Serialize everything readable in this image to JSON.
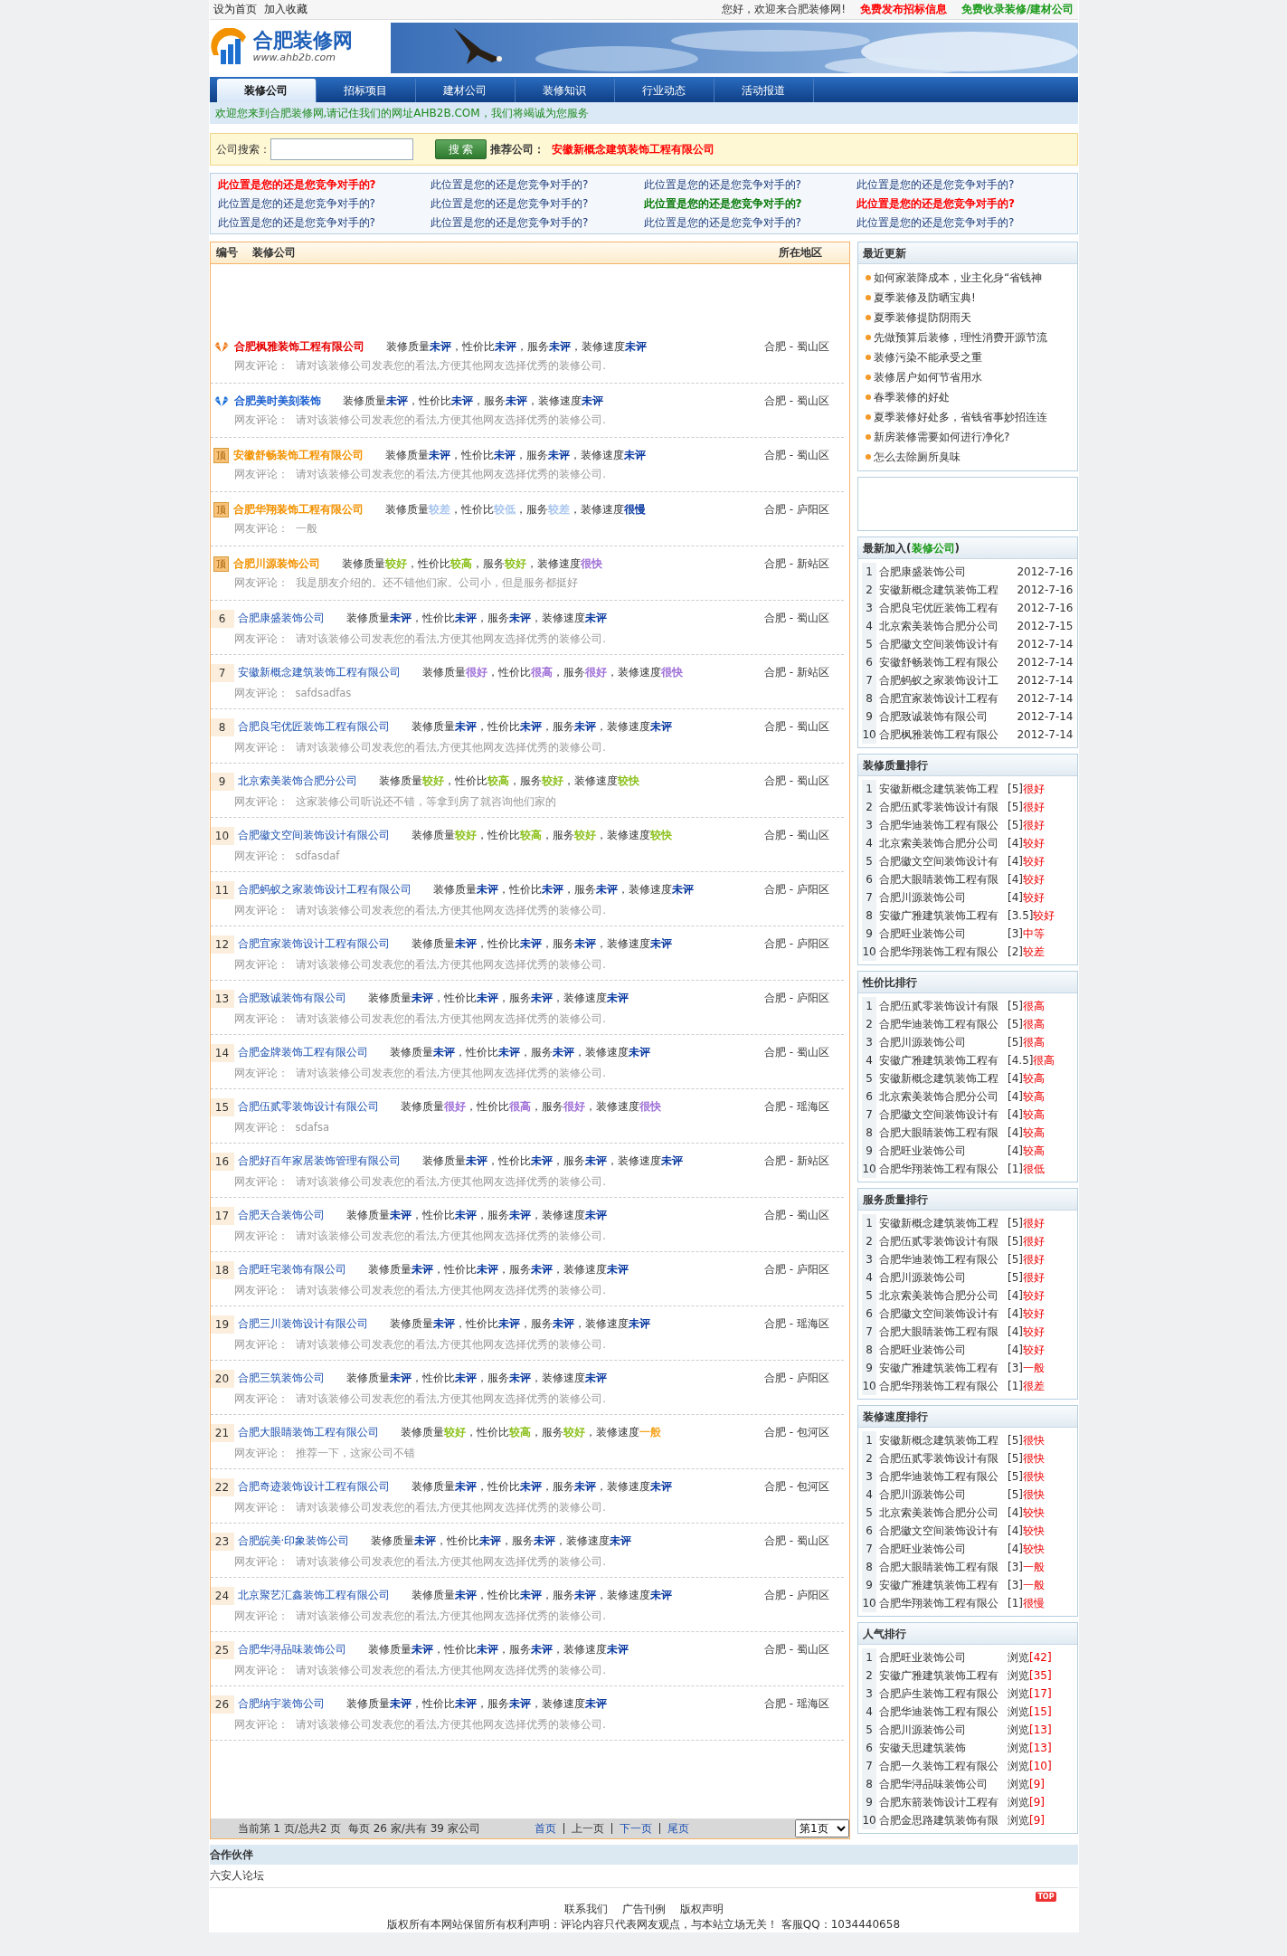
{
  "top_bar": {
    "left_links": [
      "设为首页",
      "加入收藏"
    ],
    "greeting": "您好，欢迎来合肥装修网!",
    "links": [
      {
        "text": "免费发布招标信息",
        "color": "#ff0000"
      },
      {
        "text": "免费收录装修/建材公司",
        "color": "#1a9a1a"
      }
    ]
  },
  "logo": {
    "title": "合肥装修网",
    "url": "www.ahb2b.com"
  },
  "nav": [
    {
      "label": "装修公司",
      "selected": true
    },
    {
      "label": "招标项目",
      "selected": false
    },
    {
      "label": "建材公司",
      "selected": false
    },
    {
      "label": "装修知识",
      "selected": false
    },
    {
      "label": "行业动态",
      "selected": false
    },
    {
      "label": "活动报道",
      "selected": false
    }
  ],
  "welcome": "欢迎您来到合肥装修网,请记住我们的网址AHB2B.COM，我们将竭诚为您服务",
  "search": {
    "label": "公司搜索：",
    "button": "搜 索",
    "recommend_label": "推荐公司：",
    "recommend": "安徽新概念建筑装饰工程有限公司"
  },
  "ads": [
    {
      "text": "此位置是您的还是您竞争对手的?",
      "kind": "red"
    },
    {
      "text": "此位置是您的还是您竞争对手的?",
      "kind": "plain"
    },
    {
      "text": "此位置是您的还是您竞争对手的?",
      "kind": "plain"
    },
    {
      "text": "此位置是您的还是您竞争对手的?",
      "kind": "plain"
    },
    {
      "text": "此位置是您的还是您竞争对手的?",
      "kind": "plain"
    },
    {
      "text": "此位置是您的还是您竞争对手的?",
      "kind": "plain"
    },
    {
      "text": "此位置是您的还是您竞争对手的?",
      "kind": "green"
    },
    {
      "text": "此位置是您的还是您竞争对手的?",
      "kind": "red"
    },
    {
      "text": "此位置是您的还是您竞争对手的?",
      "kind": "plain"
    },
    {
      "text": "此位置是您的还是您竞争对手的?",
      "kind": "plain"
    },
    {
      "text": "此位置是您的还是您竞争对手的?",
      "kind": "plain"
    },
    {
      "text": "此位置是您的还是您竞争对手的?",
      "kind": "plain"
    }
  ],
  "list": {
    "columns": [
      "编号",
      "装修公司",
      "所在地区"
    ],
    "rows": [
      {
        "kind": "gold",
        "name": "合肥枫雅装饰工程有限公司",
        "ratings": [
          {
            "label": "装修质量",
            "value": "未评",
            "color": "#0a3aa0"
          },
          {
            "label": "，性价比",
            "value": "未评",
            "color": "#0a3aa0"
          },
          {
            "label": "，服务",
            "value": "未评",
            "color": "#0a3aa0"
          },
          {
            "label": "，装修速度",
            "value": "未评",
            "color": "#0a3aa0"
          }
        ],
        "area": "合肥 - 蜀山区",
        "comment_label": "网友评论：",
        "comment": "请对该装修公司发表您的看法,方便其他网友选择优秀的装修公司."
      },
      {
        "kind": "silver",
        "name": "合肥美时美刻装饰",
        "ratings": [
          {
            "label": "装修质量",
            "value": "未评",
            "color": "#0a3aa0"
          },
          {
            "label": "，性价比",
            "value": "未评",
            "color": "#0a3aa0"
          },
          {
            "label": "，服务",
            "value": "未评",
            "color": "#0a3aa0"
          },
          {
            "label": "，装修速度",
            "value": "未评",
            "color": "#0a3aa0"
          }
        ],
        "area": "合肥 - 蜀山区",
        "comment_label": "网友评论：",
        "comment": "请对该装修公司发表您的看法,方便其他网友选择优秀的装修公司."
      },
      {
        "kind": "top",
        "badge": "顶",
        "name": "安徽舒畅装饰工程有限公司",
        "ratings": [
          {
            "label": "装修质量",
            "value": "未评",
            "color": "#0a3aa0"
          },
          {
            "label": "，性价比",
            "value": "未评",
            "color": "#0a3aa0"
          },
          {
            "label": "，服务",
            "value": "未评",
            "color": "#0a3aa0"
          },
          {
            "label": "，装修速度",
            "value": "未评",
            "color": "#0a3aa0"
          }
        ],
        "area": "合肥 - 蜀山区",
        "comment_label": "网友评论：",
        "comment": "请对该装修公司发表您的看法,方便其他网友选择优秀的装修公司."
      },
      {
        "kind": "top",
        "badge": "顶",
        "name": "合肥华翔装饰工程有限公司",
        "ratings": [
          {
            "label": "装修质量",
            "value": "较差",
            "color": "#a9c6ee"
          },
          {
            "label": "，性价比",
            "value": "较低",
            "color": "#a9c6ee"
          },
          {
            "label": "，服务",
            "value": "较差",
            "color": "#a9c6ee"
          },
          {
            "label": "，装修速度",
            "value": "很慢",
            "color": "#0a3aa0"
          }
        ],
        "area": "合肥 - 庐阳区",
        "comment_label": "网友评论：",
        "comment": "一般"
      },
      {
        "kind": "top",
        "badge": "顶",
        "name": "合肥川源装饰公司",
        "ratings": [
          {
            "label": "装修质量",
            "value": "较好",
            "color": "#8dc21f"
          },
          {
            "label": "，性价比",
            "value": "较高",
            "color": "#8dc21f"
          },
          {
            "label": "，服务",
            "value": "较好",
            "color": "#8dc21f"
          },
          {
            "label": "，装修速度",
            "value": "很快",
            "color": "#a070d8"
          }
        ],
        "area": "合肥 - 新站区",
        "comment_label": "网友评论：",
        "comment": "我是朋友介绍的。还不错他们家。公司小，但是服务都挺好"
      },
      {
        "kind": "normal",
        "no": "6",
        "name": "合肥康盛装饰公司",
        "ratings": [
          {
            "label": "装修质量",
            "value": "未评",
            "color": "#0a3aa0"
          },
          {
            "label": "，性价比",
            "value": "未评",
            "color": "#0a3aa0"
          },
          {
            "label": "，服务",
            "value": "未评",
            "color": "#0a3aa0"
          },
          {
            "label": "，装修速度",
            "value": "未评",
            "color": "#0a3aa0"
          }
        ],
        "area": "合肥 - 蜀山区",
        "comment_label": "网友评论：",
        "comment": "请对该装修公司发表您的看法,方便其他网友选择优秀的装修公司."
      },
      {
        "kind": "normal",
        "no": "7",
        "name": "安徽新概念建筑装饰工程有限公司",
        "ratings": [
          {
            "label": "装修质量",
            "value": "很好",
            "color": "#a070d8"
          },
          {
            "label": "，性价比",
            "value": "很高",
            "color": "#a070d8"
          },
          {
            "label": "，服务",
            "value": "很好",
            "color": "#a070d8"
          },
          {
            "label": "，装修速度",
            "value": "很快",
            "color": "#a070d8"
          }
        ],
        "area": "合肥 - 新站区",
        "comment_label": "网友评论：",
        "comment": "safdsadfas"
      },
      {
        "kind": "normal",
        "no": "8",
        "name": "合肥良宅优匠装饰工程有限公司",
        "ratings": [
          {
            "label": "装修质量",
            "value": "未评",
            "color": "#0a3aa0"
          },
          {
            "label": "，性价比",
            "value": "未评",
            "color": "#0a3aa0"
          },
          {
            "label": "，服务",
            "value": "未评",
            "color": "#0a3aa0"
          },
          {
            "label": "，装修速度",
            "value": "未评",
            "color": "#0a3aa0"
          }
        ],
        "area": "合肥 - 蜀山区",
        "comment_label": "网友评论：",
        "comment": "请对该装修公司发表您的看法,方便其他网友选择优秀的装修公司."
      },
      {
        "kind": "normal",
        "no": "9",
        "name": "北京索美装饰合肥分公司",
        "ratings": [
          {
            "label": "装修质量",
            "value": "较好",
            "color": "#8dc21f"
          },
          {
            "label": "，性价比",
            "value": "较高",
            "color": "#8dc21f"
          },
          {
            "label": "，服务",
            "value": "较好",
            "color": "#8dc21f"
          },
          {
            "label": "，装修速度",
            "value": "较快",
            "color": "#8dc21f"
          }
        ],
        "area": "合肥 - 蜀山区",
        "comment_label": "网友评论：",
        "comment": "这家装修公司听说还不错，等拿到房了就咨询他们家的"
      },
      {
        "kind": "normal",
        "no": "10",
        "name": "合肥徽文空间装饰设计有限公司",
        "ratings": [
          {
            "label": "装修质量",
            "value": "较好",
            "color": "#8dc21f"
          },
          {
            "label": "，性价比",
            "value": "较高",
            "color": "#8dc21f"
          },
          {
            "label": "，服务",
            "value": "较好",
            "color": "#8dc21f"
          },
          {
            "label": "，装修速度",
            "value": "较快",
            "color": "#8dc21f"
          }
        ],
        "area": "合肥 - 蜀山区",
        "comment_label": "网友评论：",
        "comment": "sdfasdaf"
      },
      {
        "kind": "normal",
        "no": "11",
        "name": "合肥蚂蚁之家装饰设计工程有限公司",
        "ratings": [
          {
            "label": "装修质量",
            "value": "未评",
            "color": "#0a3aa0"
          },
          {
            "label": "，性价比",
            "value": "未评",
            "color": "#0a3aa0"
          },
          {
            "label": "，服务",
            "value": "未评",
            "color": "#0a3aa0"
          },
          {
            "label": "，装修速度",
            "value": "未评",
            "color": "#0a3aa0"
          }
        ],
        "area": "合肥 - 庐阳区",
        "comment_label": "网友评论：",
        "comment": "请对该装修公司发表您的看法,方便其他网友选择优秀的装修公司."
      },
      {
        "kind": "normal",
        "no": "12",
        "name": "合肥宜家装饰设计工程有限公司",
        "ratings": [
          {
            "label": "装修质量",
            "value": "未评",
            "color": "#0a3aa0"
          },
          {
            "label": "，性价比",
            "value": "未评",
            "color": "#0a3aa0"
          },
          {
            "label": "，服务",
            "value": "未评",
            "color": "#0a3aa0"
          },
          {
            "label": "，装修速度",
            "value": "未评",
            "color": "#0a3aa0"
          }
        ],
        "area": "合肥 - 庐阳区",
        "comment_label": "网友评论：",
        "comment": "请对该装修公司发表您的看法,方便其他网友选择优秀的装修公司."
      },
      {
        "kind": "normal",
        "no": "13",
        "name": "合肥致诚装饰有限公司",
        "ratings": [
          {
            "label": "装修质量",
            "value": "未评",
            "color": "#0a3aa0"
          },
          {
            "label": "，性价比",
            "value": "未评",
            "color": "#0a3aa0"
          },
          {
            "label": "，服务",
            "value": "未评",
            "color": "#0a3aa0"
          },
          {
            "label": "，装修速度",
            "value": "未评",
            "color": "#0a3aa0"
          }
        ],
        "area": "合肥 - 庐阳区",
        "comment_label": "网友评论：",
        "comment": "请对该装修公司发表您的看法,方便其他网友选择优秀的装修公司."
      },
      {
        "kind": "normal",
        "no": "14",
        "name": "合肥金牌装饰工程有限公司",
        "ratings": [
          {
            "label": "装修质量",
            "value": "未评",
            "color": "#0a3aa0"
          },
          {
            "label": "，性价比",
            "value": "未评",
            "color": "#0a3aa0"
          },
          {
            "label": "，服务",
            "value": "未评",
            "color": "#0a3aa0"
          },
          {
            "label": "，装修速度",
            "value": "未评",
            "color": "#0a3aa0"
          }
        ],
        "area": "合肥 - 蜀山区",
        "comment_label": "网友评论：",
        "comment": "请对该装修公司发表您的看法,方便其他网友选择优秀的装修公司."
      },
      {
        "kind": "normal",
        "no": "15",
        "name": "合肥伍贰零装饰设计有限公司",
        "ratings": [
          {
            "label": "装修质量",
            "value": "很好",
            "color": "#a070d8"
          },
          {
            "label": "，性价比",
            "value": "很高",
            "color": "#a070d8"
          },
          {
            "label": "，服务",
            "value": "很好",
            "color": "#a070d8"
          },
          {
            "label": "，装修速度",
            "value": "很快",
            "color": "#a070d8"
          }
        ],
        "area": "合肥 - 瑶海区",
        "comment_label": "网友评论：",
        "comment": "sdafsa"
      },
      {
        "kind": "normal",
        "no": "16",
        "name": "合肥好百年家居装饰管理有限公司",
        "ratings": [
          {
            "label": "装修质量",
            "value": "未评",
            "color": "#0a3aa0"
          },
          {
            "label": "，性价比",
            "value": "未评",
            "color": "#0a3aa0"
          },
          {
            "label": "，服务",
            "value": "未评",
            "color": "#0a3aa0"
          },
          {
            "label": "，装修速度",
            "value": "未评",
            "color": "#0a3aa0"
          }
        ],
        "area": "合肥 - 新站区",
        "comment_label": "网友评论：",
        "comment": "请对该装修公司发表您的看法,方便其他网友选择优秀的装修公司."
      },
      {
        "kind": "normal",
        "no": "17",
        "name": "合肥天合装饰公司",
        "ratings": [
          {
            "label": "装修质量",
            "value": "未评",
            "color": "#0a3aa0"
          },
          {
            "label": "，性价比",
            "value": "未评",
            "color": "#0a3aa0"
          },
          {
            "label": "，服务",
            "value": "未评",
            "color": "#0a3aa0"
          },
          {
            "label": "，装修速度",
            "value": "未评",
            "color": "#0a3aa0"
          }
        ],
        "area": "合肥 - 蜀山区",
        "comment_label": "网友评论：",
        "comment": "请对该装修公司发表您的看法,方便其他网友选择优秀的装修公司."
      },
      {
        "kind": "normal",
        "no": "18",
        "name": "合肥旺宅装饰有限公司",
        "ratings": [
          {
            "label": "装修质量",
            "value": "未评",
            "color": "#0a3aa0"
          },
          {
            "label": "，性价比",
            "value": "未评",
            "color": "#0a3aa0"
          },
          {
            "label": "，服务",
            "value": "未评",
            "color": "#0a3aa0"
          },
          {
            "label": "，装修速度",
            "value": "未评",
            "color": "#0a3aa0"
          }
        ],
        "area": "合肥 - 庐阳区",
        "comment_label": "网友评论：",
        "comment": "请对该装修公司发表您的看法,方便其他网友选择优秀的装修公司."
      },
      {
        "kind": "normal",
        "no": "19",
        "name": "合肥三川装饰设计有限公司",
        "ratings": [
          {
            "label": "装修质量",
            "value": "未评",
            "color": "#0a3aa0"
          },
          {
            "label": "，性价比",
            "value": "未评",
            "color": "#0a3aa0"
          },
          {
            "label": "，服务",
            "value": "未评",
            "color": "#0a3aa0"
          },
          {
            "label": "，装修速度",
            "value": "未评",
            "color": "#0a3aa0"
          }
        ],
        "area": "合肥 - 瑶海区",
        "comment_label": "网友评论：",
        "comment": "请对该装修公司发表您的看法,方便其他网友选择优秀的装修公司."
      },
      {
        "kind": "normal",
        "no": "20",
        "name": "合肥三筑装饰公司",
        "ratings": [
          {
            "label": "装修质量",
            "value": "未评",
            "color": "#0a3aa0"
          },
          {
            "label": "，性价比",
            "value": "未评",
            "color": "#0a3aa0"
          },
          {
            "label": "，服务",
            "value": "未评",
            "color": "#0a3aa0"
          },
          {
            "label": "，装修速度",
            "value": "未评",
            "color": "#0a3aa0"
          }
        ],
        "area": "合肥 - 庐阳区",
        "comment_label": "网友评论：",
        "comment": "请对该装修公司发表您的看法,方便其他网友选择优秀的装修公司."
      },
      {
        "kind": "normal",
        "no": "21",
        "name": "合肥大眼睛装饰工程有限公司",
        "ratings": [
          {
            "label": "装修质量",
            "value": "较好",
            "color": "#8dc21f"
          },
          {
            "label": "，性价比",
            "value": "较高",
            "color": "#8dc21f"
          },
          {
            "label": "，服务",
            "value": "较好",
            "color": "#8dc21f"
          },
          {
            "label": "，装修速度",
            "value": "一般",
            "color": "#f5a623"
          }
        ],
        "area": "合肥 - 包河区",
        "comment_label": "网友评论：",
        "comment": "推荐一下，这家公司不错"
      },
      {
        "kind": "normal",
        "no": "22",
        "name": "合肥奇迹装饰设计工程有限公司",
        "ratings": [
          {
            "label": "装修质量",
            "value": "未评",
            "color": "#0a3aa0"
          },
          {
            "label": "，性价比",
            "value": "未评",
            "color": "#0a3aa0"
          },
          {
            "label": "，服务",
            "value": "未评",
            "color": "#0a3aa0"
          },
          {
            "label": "，装修速度",
            "value": "未评",
            "color": "#0a3aa0"
          }
        ],
        "area": "合肥 - 包河区",
        "comment_label": "网友评论：",
        "comment": "请对该装修公司发表您的看法,方便其他网友选择优秀的装修公司."
      },
      {
        "kind": "normal",
        "no": "23",
        "name": "合肥皖美·印象装饰公司",
        "ratings": [
          {
            "label": "装修质量",
            "value": "未评",
            "color": "#0a3aa0"
          },
          {
            "label": "，性价比",
            "value": "未评",
            "color": "#0a3aa0"
          },
          {
            "label": "，服务",
            "value": "未评",
            "color": "#0a3aa0"
          },
          {
            "label": "，装修速度",
            "value": "未评",
            "color": "#0a3aa0"
          }
        ],
        "area": "合肥 - 蜀山区",
        "comment_label": "网友评论：",
        "comment": "请对该装修公司发表您的看法,方便其他网友选择优秀的装修公司."
      },
      {
        "kind": "normal",
        "no": "24",
        "name": "北京聚艺汇鑫装饰工程有限公司",
        "ratings": [
          {
            "label": "装修质量",
            "value": "未评",
            "color": "#0a3aa0"
          },
          {
            "label": "，性价比",
            "value": "未评",
            "color": "#0a3aa0"
          },
          {
            "label": "，服务",
            "value": "未评",
            "color": "#0a3aa0"
          },
          {
            "label": "，装修速度",
            "value": "未评",
            "color": "#0a3aa0"
          }
        ],
        "area": "合肥 - 庐阳区",
        "comment_label": "网友评论：",
        "comment": "请对该装修公司发表您的看法,方便其他网友选择优秀的装修公司."
      },
      {
        "kind": "normal",
        "no": "25",
        "name": "合肥华浔品味装饰公司",
        "ratings": [
          {
            "label": "装修质量",
            "value": "未评",
            "color": "#0a3aa0"
          },
          {
            "label": "，性价比",
            "value": "未评",
            "color": "#0a3aa0"
          },
          {
            "label": "，服务",
            "value": "未评",
            "color": "#0a3aa0"
          },
          {
            "label": "，装修速度",
            "value": "未评",
            "color": "#0a3aa0"
          }
        ],
        "area": "合肥 - 蜀山区",
        "comment_label": "网友评论：",
        "comment": "请对该装修公司发表您的看法,方便其他网友选择优秀的装修公司."
      },
      {
        "kind": "normal",
        "no": "26",
        "name": "合肥纳宇装饰公司",
        "ratings": [
          {
            "label": "装修质量",
            "value": "未评",
            "color": "#0a3aa0"
          },
          {
            "label": "，性价比",
            "value": "未评",
            "color": "#0a3aa0"
          },
          {
            "label": "，服务",
            "value": "未评",
            "color": "#0a3aa0"
          },
          {
            "label": "，装修速度",
            "value": "未评",
            "color": "#0a3aa0"
          }
        ],
        "area": "合肥 - 瑶海区",
        "comment_label": "网友评论：",
        "comment": "请对该装修公司发表您的看法,方便其他网友选择优秀的装修公司."
      }
    ]
  },
  "pager": {
    "info": "当前第 1 页/总共2 页  每页 26 家/共有 39 家公司",
    "links": [
      {
        "text": "首页",
        "disabled": false
      },
      {
        "text": "上一页",
        "disabled": true
      },
      {
        "text": "下一页",
        "disabled": false
      },
      {
        "text": "尾页",
        "disabled": false
      }
    ],
    "page": "第1页"
  },
  "sidebar": [
    {
      "kind": "news",
      "title": "最近更新",
      "items": [
        "如何家装降成本，业主化身“省钱神",
        "夏季装修及防晒宝典!",
        "夏季装修提防阴雨天",
        "先做预算后装修，理性消费开源节流",
        "装修污染不能承受之重",
        "装修居户如何节省用水",
        "春季装修的好处",
        "夏季装修好处多，省钱省事妙招连连",
        "新房装修需要如何进行净化?",
        "怎么去除厕所臭味"
      ]
    },
    {
      "kind": "blank"
    },
    {
      "kind": "latest",
      "title": "最新加入(",
      "tag": "装修公司",
      "title_end": ")",
      "items": [
        {
          "no": "1",
          "name": "合肥康盛装饰公司",
          "date": "2012-7-16"
        },
        {
          "no": "2",
          "name": "安徽新概念建筑装饰工程",
          "date": "2012-7-16"
        },
        {
          "no": "3",
          "name": "合肥良宅优匠装饰工程有",
          "date": "2012-7-16"
        },
        {
          "no": "4",
          "name": "北京索美装饰合肥分公司",
          "date": "2012-7-15"
        },
        {
          "no": "5",
          "name": "合肥徽文空间装饰设计有",
          "date": "2012-7-14"
        },
        {
          "no": "6",
          "name": "安徽舒畅装饰工程有限公",
          "date": "2012-7-14"
        },
        {
          "no": "7",
          "name": "合肥蚂蚁之家装饰设计工",
          "date": "2012-7-14"
        },
        {
          "no": "8",
          "name": "合肥宜家装饰设计工程有",
          "date": "2012-7-14"
        },
        {
          "no": "9",
          "name": "合肥致诚装饰有限公司",
          "date": "2012-7-14"
        },
        {
          "no": "10",
          "name": "合肥枫雅装饰工程有限公",
          "date": "2012-7-14"
        }
      ]
    },
    {
      "kind": "rank",
      "title": "装修质量排行",
      "items": [
        {
          "no": "1",
          "name": "安徽新概念建筑装饰工程",
          "score": "[5]",
          "label": "很好"
        },
        {
          "no": "2",
          "name": "合肥伍贰零装饰设计有限",
          "score": "[5]",
          "label": "很好"
        },
        {
          "no": "3",
          "name": "合肥华迪装饰工程有限公",
          "score": "[5]",
          "label": "很好"
        },
        {
          "no": "4",
          "name": "北京索美装饰合肥分公司",
          "score": "[4]",
          "label": "较好"
        },
        {
          "no": "5",
          "name": "合肥徽文空间装饰设计有",
          "score": "[4]",
          "label": "较好"
        },
        {
          "no": "6",
          "name": "合肥大眼睛装饰工程有限",
          "score": "[4]",
          "label": "较好"
        },
        {
          "no": "7",
          "name": "合肥川源装饰公司",
          "score": "[4]",
          "label": "较好"
        },
        {
          "no": "8",
          "name": "安徽广雅建筑装饰工程有",
          "score": "[3.5]",
          "label": "较好"
        },
        {
          "no": "9",
          "name": "合肥旺业装饰公司",
          "score": "[3]",
          "label": "中等"
        },
        {
          "no": "10",
          "name": "合肥华翔装饰工程有限公",
          "score": "[2]",
          "label": "较差"
        }
      ]
    },
    {
      "kind": "rank",
      "title": "性价比排行",
      "items": [
        {
          "no": "1",
          "name": "合肥伍贰零装饰设计有限",
          "score": "[5]",
          "label": "很高"
        },
        {
          "no": "2",
          "name": "合肥华迪装饰工程有限公",
          "score": "[5]",
          "label": "很高"
        },
        {
          "no": "3",
          "name": "合肥川源装饰公司",
          "score": "[5]",
          "label": "很高"
        },
        {
          "no": "4",
          "name": "安徽广雅建筑装饰工程有",
          "score": "[4.5]",
          "label": "很高"
        },
        {
          "no": "5",
          "name": "安徽新概念建筑装饰工程",
          "score": "[4]",
          "label": "较高"
        },
        {
          "no": "6",
          "name": "北京索美装饰合肥分公司",
          "score": "[4]",
          "label": "较高"
        },
        {
          "no": "7",
          "name": "合肥徽文空间装饰设计有",
          "score": "[4]",
          "label": "较高"
        },
        {
          "no": "8",
          "name": "合肥大眼睛装饰工程有限",
          "score": "[4]",
          "label": "较高"
        },
        {
          "no": "9",
          "name": "合肥旺业装饰公司",
          "score": "[4]",
          "label": "较高"
        },
        {
          "no": "10",
          "name": "合肥华翔装饰工程有限公",
          "score": "[1]",
          "label": "很低"
        }
      ]
    },
    {
      "kind": "rank",
      "title": "服务质量排行",
      "items": [
        {
          "no": "1",
          "name": "安徽新概念建筑装饰工程",
          "score": "[5]",
          "label": "很好"
        },
        {
          "no": "2",
          "name": "合肥伍贰零装饰设计有限",
          "score": "[5]",
          "label": "很好"
        },
        {
          "no": "3",
          "name": "合肥华迪装饰工程有限公",
          "score": "[5]",
          "label": "很好"
        },
        {
          "no": "4",
          "name": "合肥川源装饰公司",
          "score": "[5]",
          "label": "很好"
        },
        {
          "no": "5",
          "name": "北京索美装饰合肥分公司",
          "score": "[4]",
          "label": "较好"
        },
        {
          "no": "6",
          "name": "合肥徽文空间装饰设计有",
          "score": "[4]",
          "label": "较好"
        },
        {
          "no": "7",
          "name": "合肥大眼睛装饰工程有限",
          "score": "[4]",
          "label": "较好"
        },
        {
          "no": "8",
          "name": "合肥旺业装饰公司",
          "score": "[4]",
          "label": "较好"
        },
        {
          "no": "9",
          "name": "安徽广雅建筑装饰工程有",
          "score": "[3]",
          "label": "一般"
        },
        {
          "no": "10",
          "name": "合肥华翔装饰工程有限公",
          "score": "[1]",
          "label": "很差"
        }
      ]
    },
    {
      "kind": "rank",
      "title": "装修速度排行",
      "items": [
        {
          "no": "1",
          "name": "安徽新概念建筑装饰工程",
          "score": "[5]",
          "label": "很快"
        },
        {
          "no": "2",
          "name": "合肥伍贰零装饰设计有限",
          "score": "[5]",
          "label": "很快"
        },
        {
          "no": "3",
          "name": "合肥华迪装饰工程有限公",
          "score": "[5]",
          "label": "很快"
        },
        {
          "no": "4",
          "name": "合肥川源装饰公司",
          "score": "[5]",
          "label": "很快"
        },
        {
          "no": "5",
          "name": "北京索美装饰合肥分公司",
          "score": "[4]",
          "label": "较快"
        },
        {
          "no": "6",
          "name": "合肥徽文空间装饰设计有",
          "score": "[4]",
          "label": "较快"
        },
        {
          "no": "7",
          "name": "合肥旺业装饰公司",
          "score": "[4]",
          "label": "较快"
        },
        {
          "no": "8",
          "name": "合肥大眼睛装饰工程有限",
          "score": "[3]",
          "label": "一般"
        },
        {
          "no": "9",
          "name": "安徽广雅建筑装饰工程有",
          "score": "[3]",
          "label": "一般"
        },
        {
          "no": "10",
          "name": "合肥华翔装饰工程有限公",
          "score": "[1]",
          "label": "很慢"
        }
      ]
    },
    {
      "kind": "views",
      "title": "人气排行",
      "items": [
        {
          "no": "1",
          "name": "合肥旺业装饰公司",
          "label": "浏览",
          "count": "[42]"
        },
        {
          "no": "2",
          "name": "安徽广雅建筑装饰工程有",
          "label": "浏览",
          "count": "[35]"
        },
        {
          "no": "3",
          "name": "合肥庐生装饰工程有限公",
          "label": "浏览",
          "count": "[17]"
        },
        {
          "no": "4",
          "name": "合肥华迪装饰工程有限公",
          "label": "浏览",
          "count": "[15]"
        },
        {
          "no": "5",
          "name": "合肥川源装饰公司",
          "label": "浏览",
          "count": "[13]"
        },
        {
          "no": "6",
          "name": "安徽天思建筑装饰",
          "label": "浏览",
          "count": "[13]"
        },
        {
          "no": "7",
          "name": "合肥一久装饰工程有限公",
          "label": "浏览",
          "count": "[10]"
        },
        {
          "no": "8",
          "name": "合肥华浔品味装饰公司",
          "label": "浏览",
          "count": "[9]"
        },
        {
          "no": "9",
          "name": "合肥东箭装饰设计工程有",
          "label": "浏览",
          "count": "[9]"
        },
        {
          "no": "10",
          "name": "合肥金思路建筑装饰有限",
          "label": "浏览",
          "count": "[9]"
        }
      ]
    }
  ],
  "partners": {
    "title": "合作伙伴",
    "items": [
      "六安人论坛"
    ]
  },
  "top_button": "TOP",
  "footer": {
    "links": [
      "联系我们",
      "广告刊例",
      "版权声明"
    ],
    "copyright": "版权所有本网站保留所有权利声明：评论内容只代表网友观点，与本站立场无关！ 客服QQ：1034440658"
  }
}
